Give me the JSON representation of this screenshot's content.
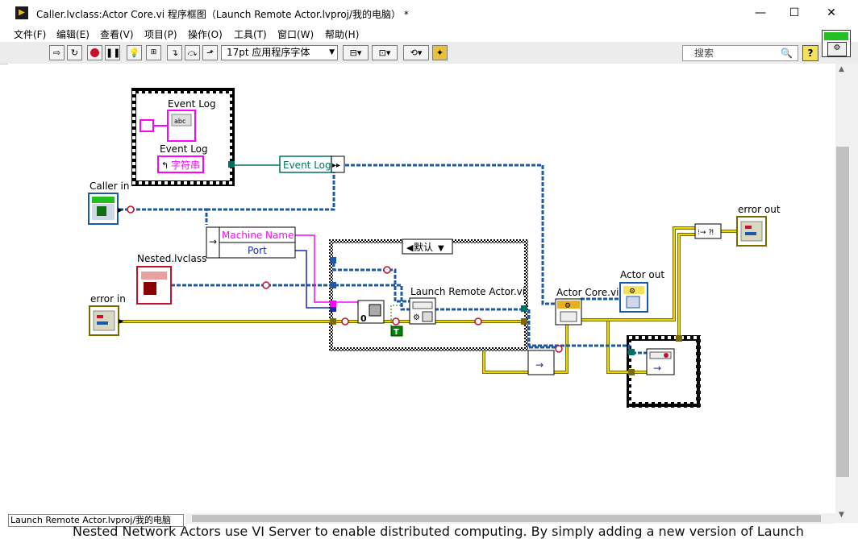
{
  "window": {
    "title": "Caller.lvclass:Actor Core.vi 程序框图（Launch Remote Actor.lvproj/我的电脑） *",
    "minimize": "—",
    "maximize": "☐",
    "close": "✕"
  },
  "menu": [
    "文件(F)",
    "编辑(E)",
    "查看(V)",
    "项目(P)",
    "操作(O)",
    "工具(T)",
    "窗口(W)",
    "帮助(H)"
  ],
  "toolbar": {
    "font_label": "17pt 应用程序字体",
    "search_placeholder": "搜索",
    "help_label": "?"
  },
  "diagram": {
    "event_log_indicator_label": "Event Log",
    "event_log_control_label": "Event Log",
    "string_const": "字符串",
    "event_log_bundle": "Event Log",
    "caller_in_label": "Caller in",
    "machine_name_label": "Machine Name",
    "port_label": "Port",
    "nested_label": "Nested.lvclass",
    "error_in_label": "error in",
    "case_selector": "默认",
    "launch_remote_label": "Launch Remote Actor.vi",
    "actor_core_label": "Actor Core.vi",
    "actor_out_label": "Actor out",
    "error_out_label": "error out",
    "true_const": "T",
    "zero_const": "0",
    "abc_text": "abc"
  },
  "status": {
    "project_context": "Launch Remote Actor.lvproj/我的电脑"
  },
  "background_text": "Nested Network Actors use VI Server to enable distributed computing. By simply adding a new version of Launch",
  "colors": {
    "error_wire": "#7a6a00",
    "error_wire_fill": "#e8d800",
    "class_wire": "#1a5aa8",
    "string_wire": "#ff00ff",
    "refnum_wire": "#007060"
  }
}
